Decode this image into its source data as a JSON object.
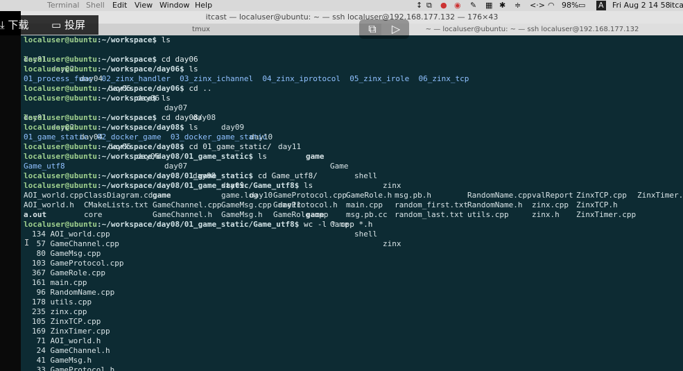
{
  "menubar": {
    "apple": "",
    "items": [
      "Terminal",
      "Shell",
      "Edit",
      "View",
      "Window",
      "Help"
    ],
    "status": {
      "battery": "98%",
      "input": "A",
      "datetime": "Fri Aug 2  14 58",
      "user": "itca"
    },
    "icons": [
      "sort-icon",
      "copy-icon",
      "rocket-icon",
      "tennis-icon",
      "edit-icon",
      "grid-icon",
      "bluetooth-icon",
      "stepper-icon",
      "code-icon",
      "wifi-icon",
      "battery-icon"
    ]
  },
  "window": {
    "title": "itcast — localuser@ubuntu: ~ — ssh localuser@192.168.177.132 — 176×43",
    "tabs": [
      {
        "label": "tmux"
      },
      {
        "label": "~ — localuser@ubuntu: ~ — ssh localuser@192.168.177.132"
      }
    ]
  },
  "overlay": {
    "download_label": "下载",
    "cast_label": "投屏",
    "icons": [
      "download-icon",
      "cast-icon",
      "pip-icon",
      "ai-play-icon"
    ]
  },
  "terminal": {
    "lines": [
      {
        "prompt": "localuser@ubuntu",
        "path": ":~/workspace$",
        "cmd": " ls"
      },
      {
        "dirs": [
          "day01",
          "day02",
          "day04",
          "day05",
          "day06",
          "day07",
          "day08",
          "day09",
          "day10",
          "day11"
        ],
        "exe": "game",
        "dirs2": [
          "Game",
          "shell",
          "zinx"
        ]
      },
      {
        "prompt": "localuser@ubuntu",
        "path": ":~/workspace$",
        "cmd": " cd day06"
      },
      {
        "prompt": "localuser@ubuntu",
        "path": ":~/workspace/day06$",
        "cmd": " ls"
      },
      {
        "text": "01_process_func  02_zinx_handler  03_zinx_ichannel  04_zinx_iprotocol  05_zinx_irole  06_zinx_tcp",
        "cls": "dir"
      },
      {
        "prompt": "localuser@ubuntu",
        "path": ":~/workspace/day06$",
        "cmd": " cd .."
      },
      {
        "prompt": "localuser@ubuntu",
        "path": ":~/workspace$",
        "cmd": " ls"
      },
      {
        "dirs": [
          "day01",
          "day02",
          "day04",
          "day05",
          "day06",
          "day07",
          "day08",
          "day09",
          "day10",
          "day11"
        ],
        "exe": "game",
        "dirs2": [
          "Game",
          "shell",
          "zinx"
        ]
      },
      {
        "prompt": "localuser@ubuntu",
        "path": ":~/workspace$",
        "cmd": " cd day08/"
      },
      {
        "prompt": "localuser@ubuntu",
        "path": ":~/workspace/day08$",
        "cmd": " ls"
      },
      {
        "text": "01_game_static  02_docker_game  03_docker_game_static",
        "cls": "dir"
      },
      {
        "prompt": "localuser@ubuntu",
        "path": ":~/workspace/day08$",
        "cmd": " cd 01_game_static/"
      },
      {
        "prompt": "localuser@ubuntu",
        "path": ":~/workspace/day08/01_game_static$",
        "cmd": " ls"
      },
      {
        "text": "Game_utf8",
        "cls": "dir"
      },
      {
        "prompt": "localuser@ubuntu",
        "path": ":~/workspace/day08/01_game_static$",
        "cmd": " cd Game_utf8/"
      },
      {
        "prompt": "localuser@ubuntu",
        "path": ":~/workspace/day08/01_game_static/Game_utf8$",
        "cmd": " ls"
      }
    ],
    "ls_grid": [
      [
        "AOI_world.cpp",
        "ClassDiagram.cd",
        "game",
        "game.log",
        "GameProtocol.cpp",
        "GameRole.h",
        "msg.pb.h",
        "RandomName.cpp",
        "valReport",
        "ZinxTCP.cpp",
        "ZinxTimer.h"
      ],
      [
        "AOI_world.h",
        "CMakeLists.txt",
        "GameChannel.cpp",
        "GameMsg.cpp",
        "GameProtocol.h",
        "main.cpp",
        "random_first.txt",
        "RandomName.h",
        "zinx.cpp",
        "ZinxTCP.h",
        ""
      ],
      [
        "a.out",
        "core",
        "GameChannel.h",
        "GameMsg.h",
        "GameRole.cpp",
        "msg.pb.cc",
        "random_last.txt",
        "utils.cpp",
        "zinx.h",
        "ZinxTimer.cpp",
        ""
      ]
    ],
    "wc_prompt": {
      "prompt": "localuser@ubuntu",
      "path": ":~/workspace/day08/01_game_static/Game_utf8$",
      "cmd": " wc -l *.cpp *.h"
    },
    "wc_lines": [
      "134 AOI_world.cpp",
      " 57 GameChannel.cpp",
      " 80 GameMsg.cpp",
      "103 GameProtocol.cpp",
      "367 GameRole.cpp",
      "161 main.cpp",
      " 96 RandomName.cpp",
      "178 utils.cpp",
      "235 zinx.cpp",
      "105 ZinxTCP.cpp",
      "169 ZinxTimer.cpp",
      " 71 AOI_world.h",
      " 24 GameChannel.h",
      " 41 GameMsg.h",
      " 33 GameProtocol.h"
    ]
  },
  "colors": {
    "terminal_bg": "#0d2b33",
    "prompt": "#9fd08e",
    "directory": "#8fc0ff",
    "executable": "#b5e05a"
  }
}
